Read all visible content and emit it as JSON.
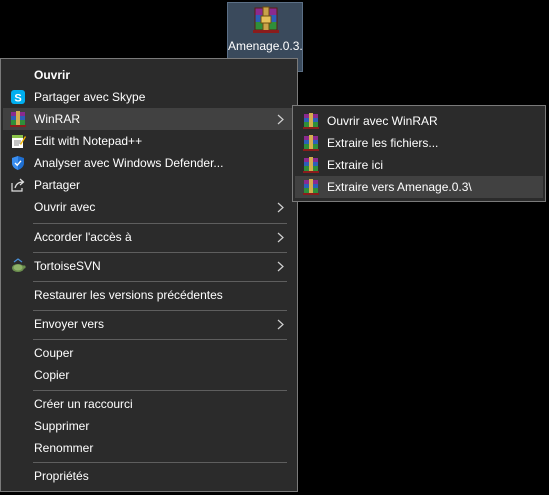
{
  "desktop_file": {
    "name": "Amenage.0.3.",
    "name_tail": "·",
    "icon": "winrar-archive-icon"
  },
  "context_menu": {
    "items": [
      {
        "label": "Ouvrir",
        "icon": null
      },
      {
        "label": "Partager avec Skype",
        "icon": "skype-icon"
      },
      {
        "label": "WinRAR",
        "icon": "winrar-icon"
      },
      {
        "label": "Edit with Notepad++",
        "icon": "notepadpp-icon"
      },
      {
        "label": "Analyser avec Windows Defender...",
        "icon": "windows-defender-icon"
      },
      {
        "label": "Partager",
        "icon": "share-icon"
      },
      {
        "label": "Ouvrir avec",
        "icon": null
      },
      {
        "label": "Accorder l'accès à",
        "icon": null
      },
      {
        "label": "TortoiseSVN",
        "icon": "tortoisesvn-icon"
      },
      {
        "label": "Restaurer les versions précédentes",
        "icon": null
      },
      {
        "label": "Envoyer vers",
        "icon": null
      },
      {
        "label": "Couper",
        "icon": null
      },
      {
        "label": "Copier",
        "icon": null
      },
      {
        "label": "Créer un raccourci",
        "icon": null
      },
      {
        "label": "Supprimer",
        "icon": null
      },
      {
        "label": "Renommer",
        "icon": null
      },
      {
        "label": "Propriétés",
        "icon": null
      }
    ]
  },
  "winrar_submenu": {
    "items": [
      {
        "label": "Ouvrir avec WinRAR",
        "icon": "winrar-icon"
      },
      {
        "label": "Extraire les fichiers...",
        "icon": "winrar-icon"
      },
      {
        "label": "Extraire ici",
        "icon": "winrar-icon"
      },
      {
        "label": "Extraire vers Amenage.0.3\\",
        "icon": "winrar-icon"
      }
    ]
  },
  "colors": {
    "menu_background": "#2b2b2b",
    "menu_border": "#7a7a7a",
    "hover_background": "#414141",
    "separator": "#5e5e5e",
    "desktop_background": "#000000",
    "selected_file_background": "#3a4a5c",
    "skype_blue": "#00aff0"
  }
}
